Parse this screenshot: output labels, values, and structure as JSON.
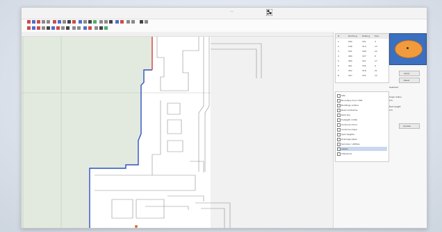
{
  "window": {
    "title": "···",
    "app_icon": "app-icon"
  },
  "toolbar": {
    "icons": [
      "open-icon",
      "save-icon",
      "print-icon",
      "undo-icon",
      "redo-icon",
      "zoom-icon",
      "pan-icon",
      "select-icon",
      "draw-line-icon",
      "draw-polygon-icon",
      "measure-icon",
      "layer-icon",
      "grid-icon",
      "snap-icon"
    ]
  },
  "point_table": {
    "headers": [
      "#",
      "Northing",
      "Easting",
      "Elev"
    ],
    "rows": [
      [
        "1",
        "560",
        "301",
        "4"
      ],
      [
        "2",
        "548",
        "314",
        "13"
      ],
      [
        "3",
        "501",
        "308",
        "22"
      ],
      [
        "4",
        "489",
        "327",
        "8"
      ],
      [
        "5",
        "480",
        "321",
        "17"
      ],
      [
        "6",
        "461",
        "330",
        "9"
      ],
      [
        "7",
        "452",
        "318",
        "21"
      ],
      [
        "8",
        "447",
        "325",
        "12"
      ]
    ]
  },
  "layers_panel": {
    "items": [
      "Site",
      "Boundary line 1:500",
      "Buildings outline",
      "Road centreline",
      "Kerb line",
      "Footpath 1:500",
      "Contours minor",
      "Contours major",
      "Spot heights",
      "Drainage pipes",
      "Services / utilities",
      "Labels",
      "Title block"
    ],
    "selected_index": 11
  },
  "side_options": {
    "button1": "Apply",
    "button2": "Reset",
    "label_a": "Selected",
    "label_b": "Snap radius",
    "value_b": "0.5",
    "label_c": "Text height",
    "value_c": "2.5",
    "button3": "Update"
  },
  "colors": {
    "map_fill_left": "#e2eadf",
    "boundary_blue": "#2d4fbf",
    "boundary_red": "#d63b3b",
    "gis_blue": "#3b6fbf",
    "gis_orange": "#f29b3c"
  }
}
